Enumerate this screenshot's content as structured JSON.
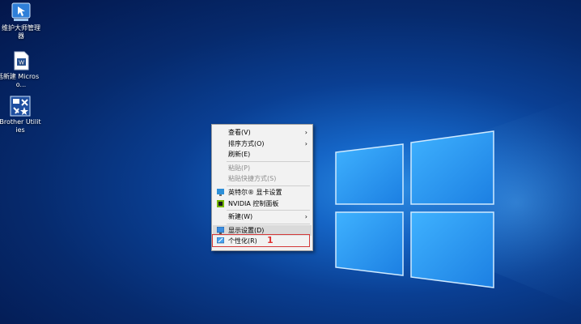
{
  "desktop": {
    "icons": [
      {
        "label": "维护大师管理器",
        "icon": "maintenance-tool-icon"
      },
      {
        "label": "新建 Microso...",
        "icon": "word-document-icon"
      },
      {
        "label": "Brother Utilities",
        "icon": "brother-utilities-icon"
      }
    ],
    "edge_fragment": "话"
  },
  "context_menu": {
    "items": [
      {
        "label": "查看(V)",
        "submenu": true
      },
      {
        "label": "排序方式(O)",
        "submenu": true
      },
      {
        "label": "刷新(E)"
      },
      {
        "label": "粘贴(P)",
        "disabled": true
      },
      {
        "label": "粘贴快捷方式(S)",
        "disabled": true
      },
      {
        "label": "英特尔® 显卡设置",
        "icon": "intel-graphics-icon"
      },
      {
        "label": "NVIDIA 控制面板",
        "icon": "nvidia-icon"
      },
      {
        "label": "新建(W)",
        "submenu": true
      },
      {
        "label": "显示设置(D)",
        "icon": "display-settings-icon"
      },
      {
        "label": "个性化(R)",
        "icon": "personalize-icon"
      }
    ],
    "arrow_glyph": "›"
  },
  "annotation": {
    "number": "1",
    "color": "#d33a3a"
  }
}
